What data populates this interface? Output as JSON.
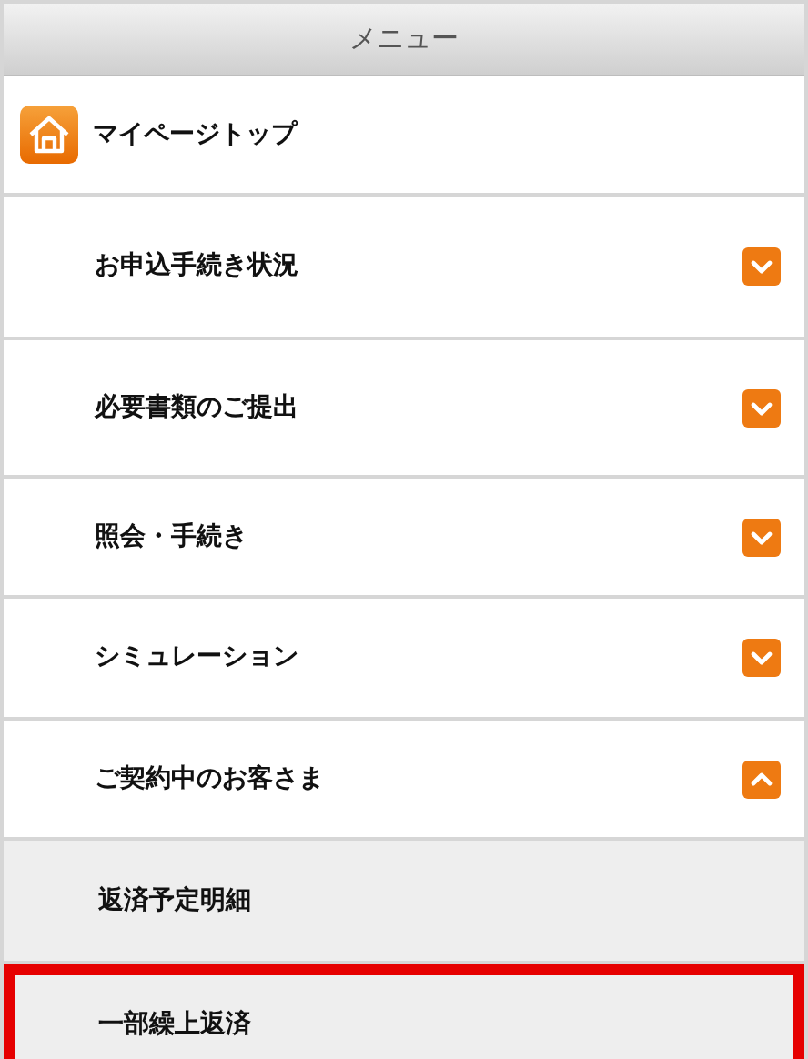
{
  "header": {
    "title": "メニュー"
  },
  "items": [
    {
      "kind": "home",
      "label": "マイページトップ"
    },
    {
      "kind": "section",
      "label": "お申込手続き状況",
      "expanded": false
    },
    {
      "kind": "section",
      "label": "必要書類のご提出",
      "expanded": false
    },
    {
      "kind": "section",
      "label": "照会・手続き",
      "expanded": false
    },
    {
      "kind": "section",
      "label": "シミュレーション",
      "expanded": false
    },
    {
      "kind": "section",
      "label": "ご契約中のお客さま",
      "expanded": true
    },
    {
      "kind": "subitem",
      "label": "返済予定明細",
      "highlighted": false
    },
    {
      "kind": "subitem",
      "label": "一部繰上返済",
      "highlighted": true
    }
  ]
}
